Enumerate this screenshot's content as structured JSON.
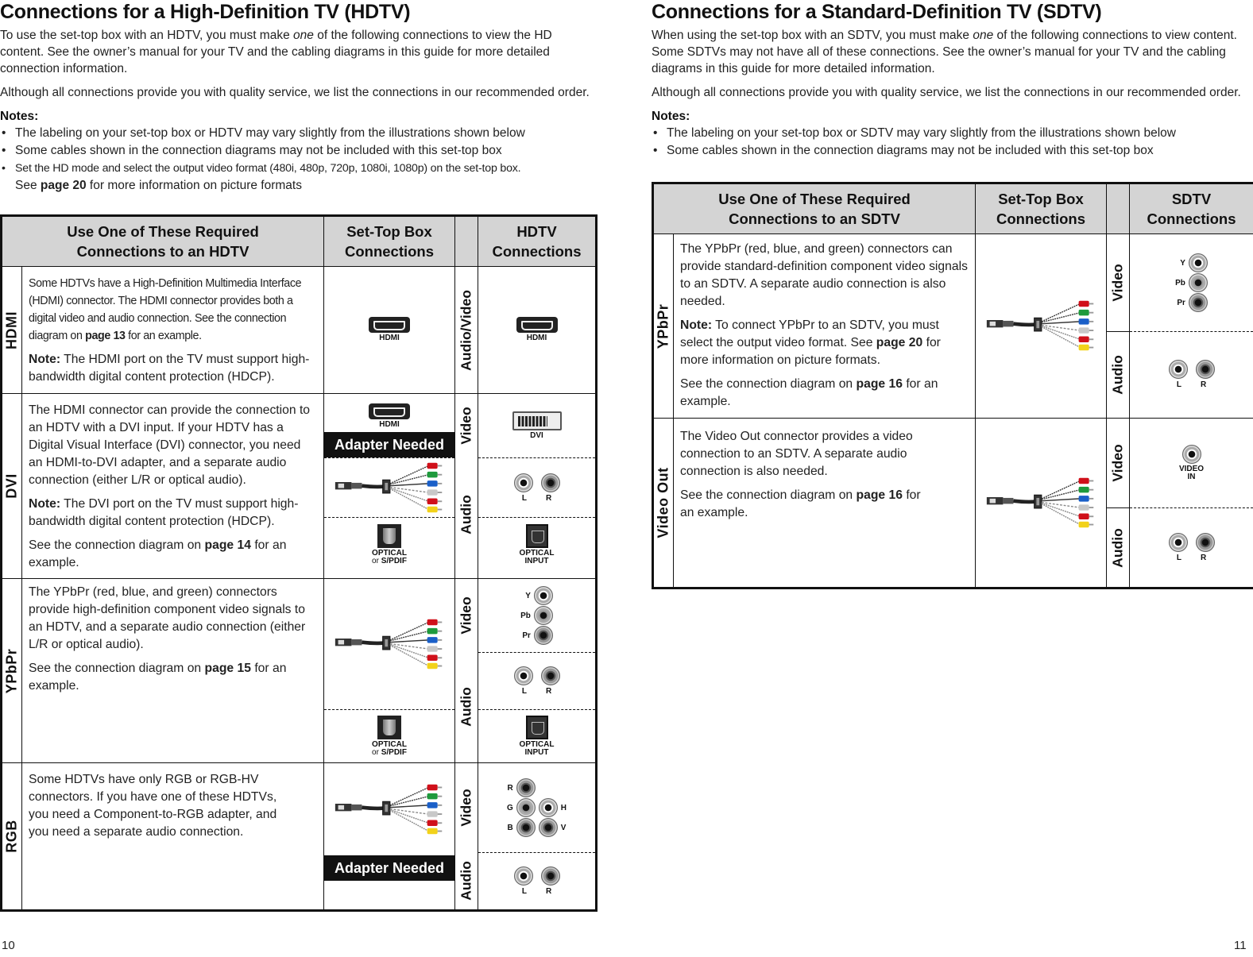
{
  "left_page": {
    "title": "Connections for a High-Definition TV (HDTV)",
    "intro": {
      "p1_before": "To use the set-top box with an HDTV, you must make ",
      "p1_em": "one",
      "p1_after": " of the following connections to view the HD content. See the owner’s manual for your TV and the cabling diagrams in this guide for more detailed connection information.",
      "p2": "Although all connections provide you with quality service, we list the connections in our recommended order.",
      "notes_title": "Notes:",
      "notes": [
        "The labeling on your set-top box or HDTV may vary slightly from the illustrations shown below",
        "Some cables shown in the connection diagrams may not be included with this set-top box",
        "Set the HD mode and select the output video format (480i, 480p, 720p, 1080i, 1080p) on the set-top box."
      ],
      "note3_line2_before": "See ",
      "note3_line2_bold": "page 20",
      "note3_line2_after": " for more information on picture formats"
    },
    "table": {
      "headers": {
        "required": "Use One of These Required\nConnections to an HDTV",
        "stb": "Set-Top Box\nConnections",
        "tv": "HDTV\nConnections"
      },
      "rows": {
        "hdmi": {
          "label": "HDMI",
          "text1_before": "Some HDTVs have a High-Definition Multimedia Interface (HDMI) connector. The HDMI connector provides both a digital video and audio connection. See the connection diagram on ",
          "text1_bold": "page 13",
          "text1_after": " for an example.",
          "note_label": "Note:",
          "note_text": " The HDMI port on the TV must support high-bandwidth digital content protection (HDCP).",
          "signal": "Audio/Video",
          "stb_port": "HDMI",
          "tv_port": "HDMI"
        },
        "dvi": {
          "label": "DVI",
          "text1": "The HDMI connector can provide the connection to an HDTV with a DVI input. If your HDTV has a Digital Visual Interface (DVI) connector, you need an HDMI-to-DVI adapter, and a separate audio connection (either L/R or optical audio).",
          "note_label": "Note:",
          "note_text": " The DVI port on the TV must support high-bandwidth digital content protection (HDCP).",
          "text3_before": "See the connection diagram on ",
          "text3_bold": "page 14",
          "text3_after": " for an example.",
          "signal_video": "Video",
          "signal_audio": "Audio",
          "stb_port": "HDMI",
          "adapter": "Adapter Needed",
          "stb_optical_1": "OPTICAL",
          "stb_optical_2_or": "or ",
          "stb_optical_2": "S/PDIF",
          "tv_video_port": "DVI",
          "tv_audio_l": "L",
          "tv_audio_r": "R",
          "tv_optical_1": "OPTICAL",
          "tv_optical_2": "INPUT"
        },
        "ypbpr": {
          "label": "YPbPr",
          "text1": "The YPbPr (red, blue, and green) connectors provide high-definition component video signals to an HDTV, and a separate audio connection (either L/R or optical audio).",
          "text2_before": "See the connection diagram on ",
          "text2_bold": "page 15",
          "text2_after": " for an example.",
          "signal_video": "Video",
          "signal_audio": "Audio",
          "stb_optical_1": "OPTICAL",
          "stb_optical_2_or": "or ",
          "stb_optical_2": "S/PDIF",
          "tv_video": [
            "Y",
            "Pb",
            "Pr"
          ],
          "tv_audio_l": "L",
          "tv_audio_r": "R",
          "tv_optical_1": "OPTICAL",
          "tv_optical_2": "INPUT"
        },
        "rgb": {
          "label": "RGB",
          "text1": "Some HDTVs have only RGB or RGB-HV connectors. If you have one of these HDTVs, you need a Component-to-RGB adapter, and you need a separate audio connection.",
          "signal_video": "Video",
          "signal_audio": "Audio",
          "adapter": "Adapter Needed",
          "tv_video_left": [
            "R",
            "G",
            "B"
          ],
          "tv_video_right": [
            "H",
            "V"
          ],
          "tv_audio_l": "L",
          "tv_audio_r": "R"
        }
      }
    },
    "page_number": "10"
  },
  "right_page": {
    "title": "Connections for a Standard-Definition TV (SDTV)",
    "intro": {
      "p1_before": "When using the set-top box with an SDTV, you must make ",
      "p1_em": "one",
      "p1_after": " of the following connections to view content. Some SDTVs may not have all of these connections. See the owner’s manual for your TV and the cabling diagrams in this guide for more detailed information.",
      "p2": "Although all connections provide you with quality service, we list the connections in our recommended order.",
      "notes_title": "Notes:",
      "notes": [
        "The labeling on your set-top box or SDTV may vary slightly from the illustrations shown below",
        "Some cables shown in the connection diagrams may not be included with this set-top box"
      ]
    },
    "table": {
      "headers": {
        "required": "Use One of These Required\nConnections to an SDTV",
        "stb": "Set-Top Box\nConnections",
        "tv": "SDTV\nConnections"
      },
      "rows": {
        "ypbpr": {
          "label": "YPbPr",
          "text1": "The YPbPr (red, blue, and green) connectors can provide standard-definition component video signals to an SDTV. A separate audio connection is also needed.",
          "note_label": "Note:",
          "note_before": " To connect YPbPr to an SDTV, you must select the output video format. See ",
          "note_bold": "page 20",
          "note_after": " for more information on picture formats.",
          "text3_before": "See the connection diagram on ",
          "text3_bold": "page 16",
          "text3_after": " for an example.",
          "signal_video": "Video",
          "signal_audio": "Audio",
          "tv_video": [
            "Y",
            "Pb",
            "Pr"
          ],
          "tv_audio_l": "L",
          "tv_audio_r": "R"
        },
        "video_out": {
          "label": "Video Out",
          "text1": "The Video Out connector provides a video connection to an SDTV. A separate audio connection is also needed.",
          "text2_before": "See the connection diagram on ",
          "text2_bold": "page 16",
          "text2_after": " for an example.",
          "signal_video": "Video",
          "signal_audio": "Audio",
          "tv_video_1": "VIDEO",
          "tv_video_2": "IN",
          "tv_audio_l": "L",
          "tv_audio_r": "R"
        }
      }
    },
    "page_number": "11"
  },
  "colors": {
    "header_bg": "#d4d4d4",
    "adapter_bg": "#111111",
    "cable_red": "#d0101a",
    "cable_green": "#1e9a3c",
    "cable_blue": "#1a5fc8",
    "cable_white": "#c8c8c8",
    "cable_yellow": "#f2d21a"
  }
}
